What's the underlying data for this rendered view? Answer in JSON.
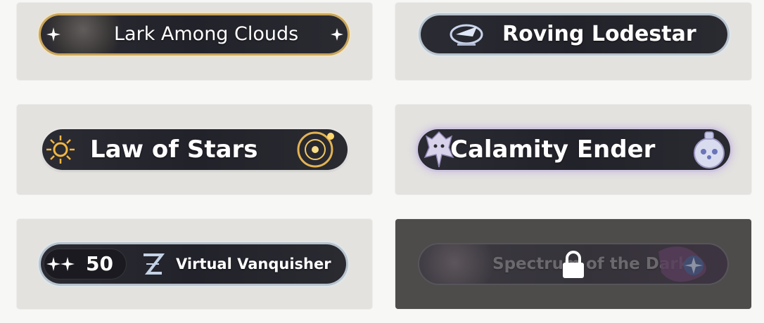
{
  "titles": [
    {
      "name": "Lark Among Clouds",
      "locked": false
    },
    {
      "name": "Roving Lodestar",
      "locked": false
    },
    {
      "name": "Law of Stars",
      "locked": false
    },
    {
      "name": "Calamity Ender",
      "locked": false
    },
    {
      "name": "Virtual Vanquisher",
      "badge_value": "50",
      "locked": false
    },
    {
      "name": "Spectrum of the Dark",
      "locked": true
    }
  ],
  "icons": {
    "sparkle": "sparkle-icon",
    "emblem": "lodestar-emblem-icon",
    "sun": "sun-icon",
    "orbit": "orbit-icon",
    "dragon": "dragon-icon",
    "bottle": "bottle-icon",
    "z": "z-logo-icon",
    "lock": "lock-icon"
  },
  "colors": {
    "gold": "#c9a55a",
    "panel": "#e3e2df",
    "plate": "#24242c"
  }
}
